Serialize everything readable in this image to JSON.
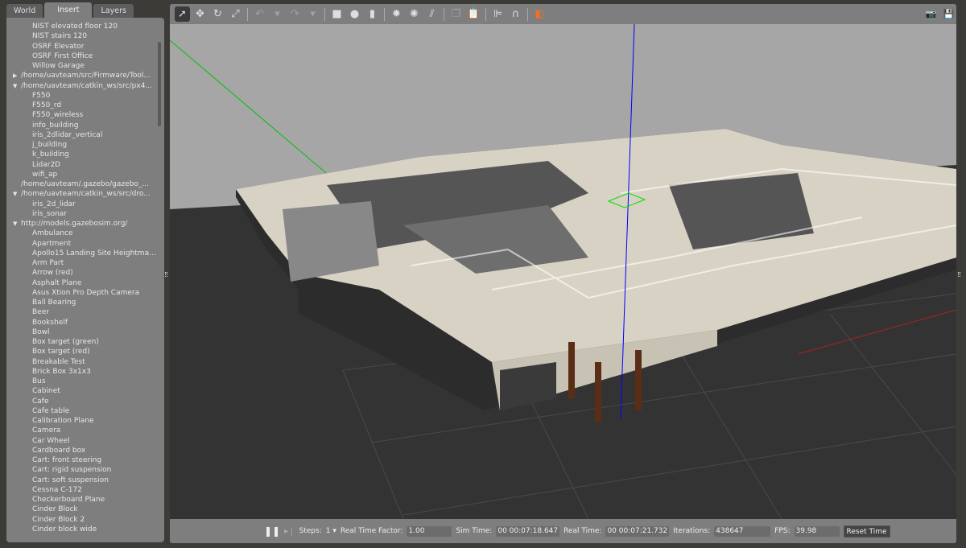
{
  "left_panel": {
    "tabs": [
      {
        "label": "World"
      },
      {
        "label": "Insert",
        "active": true
      },
      {
        "label": "Layers"
      }
    ],
    "items": [
      {
        "label": "NIST elevated floor 120",
        "level": 1
      },
      {
        "label": "NIST stairs 120",
        "level": 1
      },
      {
        "label": "OSRF Elevator",
        "level": 1
      },
      {
        "label": "OSRF First Office",
        "level": 1
      },
      {
        "label": "Willow Garage",
        "level": 1
      },
      {
        "label": "/home/uavteam/src/Firmware/Tool...",
        "level": 0,
        "arrow": "▶"
      },
      {
        "label": "/home/uavteam/catkin_ws/src/px4...",
        "level": 0,
        "arrow": "▼"
      },
      {
        "label": "F550",
        "level": 1
      },
      {
        "label": "F550_rd",
        "level": 1
      },
      {
        "label": "F550_wireless",
        "level": 1
      },
      {
        "label": "info_building",
        "level": 1
      },
      {
        "label": "iris_2dlidar_vertical",
        "level": 1
      },
      {
        "label": "j_building",
        "level": 1
      },
      {
        "label": "k_building",
        "level": 1
      },
      {
        "label": "Lidar2D",
        "level": 1
      },
      {
        "label": "wifi_ap",
        "level": 1
      },
      {
        "label": "/home/uavteam/.gazebo/gazebo_...",
        "level": 0,
        "arrow": ""
      },
      {
        "label": "/home/uavteam/catkin_ws/src/dro...",
        "level": 0,
        "arrow": "▼"
      },
      {
        "label": "iris_2d_lidar",
        "level": 1
      },
      {
        "label": "iris_sonar",
        "level": 1
      },
      {
        "label": "http://models.gazebosim.org/",
        "level": 0,
        "arrow": "▼"
      },
      {
        "label": "Ambulance",
        "level": 1
      },
      {
        "label": "Apartment",
        "level": 1
      },
      {
        "label": "Apollo15 Landing Site Heightma...",
        "level": 1
      },
      {
        "label": "Arm Part",
        "level": 1
      },
      {
        "label": "Arrow (red)",
        "level": 1
      },
      {
        "label": "Asphalt Plane",
        "level": 1
      },
      {
        "label": "Asus Xtion Pro Depth Camera",
        "level": 1
      },
      {
        "label": "Ball Bearing",
        "level": 1
      },
      {
        "label": "Beer",
        "level": 1
      },
      {
        "label": "Bookshelf",
        "level": 1
      },
      {
        "label": "Bowl",
        "level": 1
      },
      {
        "label": "Box target (green)",
        "level": 1
      },
      {
        "label": "Box target (red)",
        "level": 1
      },
      {
        "label": "Breakable Test",
        "level": 1
      },
      {
        "label": "Brick Box 3x1x3",
        "level": 1
      },
      {
        "label": "Bus",
        "level": 1
      },
      {
        "label": "Cabinet",
        "level": 1
      },
      {
        "label": "Cafe",
        "level": 1
      },
      {
        "label": "Cafe table",
        "level": 1
      },
      {
        "label": "Calibration Plane",
        "level": 1
      },
      {
        "label": "Camera",
        "level": 1
      },
      {
        "label": "Car Wheel",
        "level": 1
      },
      {
        "label": "Cardboard box",
        "level": 1
      },
      {
        "label": "Cart: front steering",
        "level": 1
      },
      {
        "label": "Cart: rigid suspension",
        "level": 1
      },
      {
        "label": "Cart: soft suspension",
        "level": 1
      },
      {
        "label": "Cessna C-172",
        "level": 1
      },
      {
        "label": "Checkerboard Plane",
        "level": 1
      },
      {
        "label": "Cinder Block",
        "level": 1
      },
      {
        "label": "Cinder Block 2",
        "level": 1
      },
      {
        "label": "Cinder block wide",
        "level": 1
      }
    ]
  },
  "toolbar": {
    "tools": [
      {
        "name": "select-mode-icon",
        "glyph": "➚",
        "active": true
      },
      {
        "name": "translate-mode-icon",
        "glyph": "✥"
      },
      {
        "name": "rotate-mode-icon",
        "glyph": "↻"
      },
      {
        "name": "scale-mode-icon",
        "glyph": "⤢"
      },
      {
        "sep": true
      },
      {
        "name": "undo-icon",
        "glyph": "↶",
        "dim": true
      },
      {
        "name": "undo-dropdown-icon",
        "glyph": "▾",
        "dim": true
      },
      {
        "name": "redo-icon",
        "glyph": "↷",
        "dim": true
      },
      {
        "name": "redo-dropdown-icon",
        "glyph": "▾",
        "dim": true
      },
      {
        "sep": true
      },
      {
        "name": "box-icon",
        "glyph": "■"
      },
      {
        "name": "sphere-icon",
        "glyph": "●"
      },
      {
        "name": "cylinder-icon",
        "glyph": "▮"
      },
      {
        "sep": true
      },
      {
        "name": "point-light-icon",
        "glyph": "✹"
      },
      {
        "name": "spot-light-icon",
        "glyph": "✺"
      },
      {
        "name": "directional-light-icon",
        "glyph": "⫽"
      },
      {
        "sep": true
      },
      {
        "name": "copy-icon",
        "glyph": "❐",
        "dim": true
      },
      {
        "name": "paste-icon",
        "glyph": "📋",
        "dim": true
      },
      {
        "sep": true
      },
      {
        "name": "align-icon",
        "glyph": "⊫"
      },
      {
        "name": "snap-icon",
        "glyph": "∩"
      },
      {
        "sep": true
      },
      {
        "name": "view-angle-icon",
        "glyph": "◧",
        "color": "#f07020"
      }
    ],
    "right": [
      {
        "name": "screenshot-icon",
        "glyph": "📷"
      },
      {
        "name": "log-icon",
        "glyph": "💾"
      }
    ]
  },
  "bottom_bar": {
    "steps_label": "Steps:",
    "steps_value": "1",
    "rtf_label": "Real Time Factor:",
    "rtf_value": "1.00",
    "sim_time_label": "Sim Time:",
    "sim_time_value": "00 00:07:18.647",
    "real_time_label": "Real Time:",
    "real_time_value": "00 00:07:21.732",
    "iterations_label": "Iterations:",
    "iterations_value": "438647",
    "fps_label": "FPS:",
    "fps_value": "39.98",
    "reset_label": "Reset Time"
  },
  "colors": {
    "sky": "#a6a6a6",
    "ground": "#333333",
    "walls": "#d8d2c4",
    "accent": "#f07020",
    "z_axis": "#0000ff",
    "y_axis": "#00c000",
    "x_axis": "#c00000"
  }
}
